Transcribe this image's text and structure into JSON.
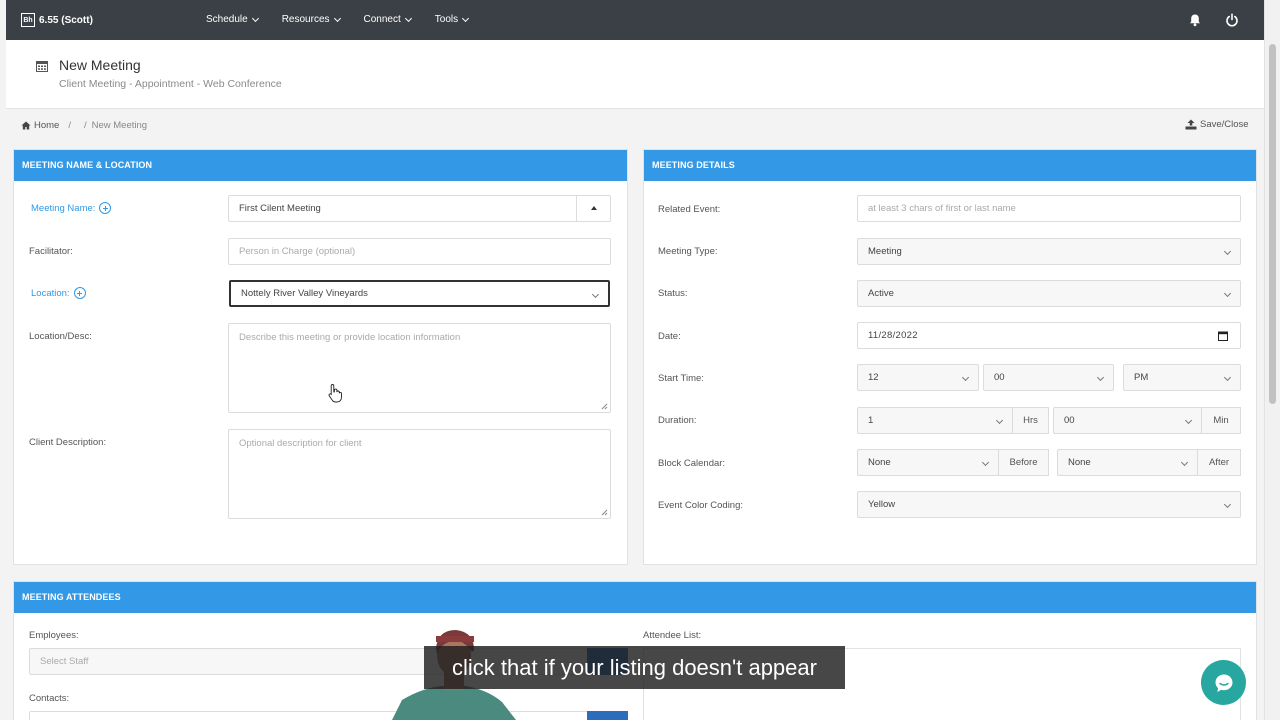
{
  "topbar": {
    "brand_logo": "Bh",
    "brand": "6.55 (Scott)",
    "nav": [
      {
        "label": "Schedule"
      },
      {
        "label": "Resources"
      },
      {
        "label": "Connect"
      },
      {
        "label": "Tools"
      }
    ],
    "icons": [
      "bell-icon",
      "power-icon"
    ]
  },
  "page": {
    "title": "New Meeting",
    "subtitle": "Client Meeting - Appointment - Web Conference"
  },
  "breadcrumb": {
    "home": "Home",
    "sep": "/",
    "sep2": "/",
    "current": "New Meeting",
    "save_close": "Save/Close"
  },
  "name_location": {
    "header": "MEETING NAME & LOCATION",
    "meeting_name_label": "Meeting Name:",
    "meeting_name_value": "First Cilent Meeting",
    "facilitator_label": "Facilitator:",
    "facilitator_placeholder": "Person in Charge (optional)",
    "location_label": "Location:",
    "location_value": "Nottely River Valley Vineyards",
    "location_desc_label": "Location/Desc:",
    "location_desc_placeholder": "Describe this meeting or provide location information",
    "client_desc_label": "Client Description:",
    "client_desc_placeholder": "Optional description for client"
  },
  "details": {
    "header": "MEETING DETAILS",
    "related_event_label": "Related Event:",
    "related_event_placeholder": "at least 3 chars of first or last name",
    "meeting_type_label": "Meeting Type:",
    "meeting_type_value": "Meeting",
    "status_label": "Status:",
    "status_value": "Active",
    "date_label": "Date:",
    "date_value": "11/28/2022",
    "start_time_label": "Start Time:",
    "start_hour": "12",
    "start_minute": "00",
    "start_ampm": "PM",
    "duration_label": "Duration:",
    "duration_hours": "1",
    "hrs_label": "Hrs",
    "duration_minutes": "00",
    "min_label": "Min",
    "block_calendar_label": "Block Calendar:",
    "block_before_value": "None",
    "before_label": "Before",
    "block_after_value": "None",
    "after_label": "After",
    "color_coding_label": "Event Color Coding:",
    "color_coding_value": "Yellow"
  },
  "attendees": {
    "header": "MEETING ATTENDEES",
    "employees_label": "Employees:",
    "employees_placeholder": "Select Staff",
    "contacts_label": "Contacts:",
    "attendee_list_label": "Attendee List:"
  },
  "caption": "click that if your listing doesn't appear",
  "colors": {
    "navbar": "#3b4046",
    "panel_header": "#3399e6",
    "accent_blue": "#3399e6",
    "chat_button": "#28a6a0"
  }
}
